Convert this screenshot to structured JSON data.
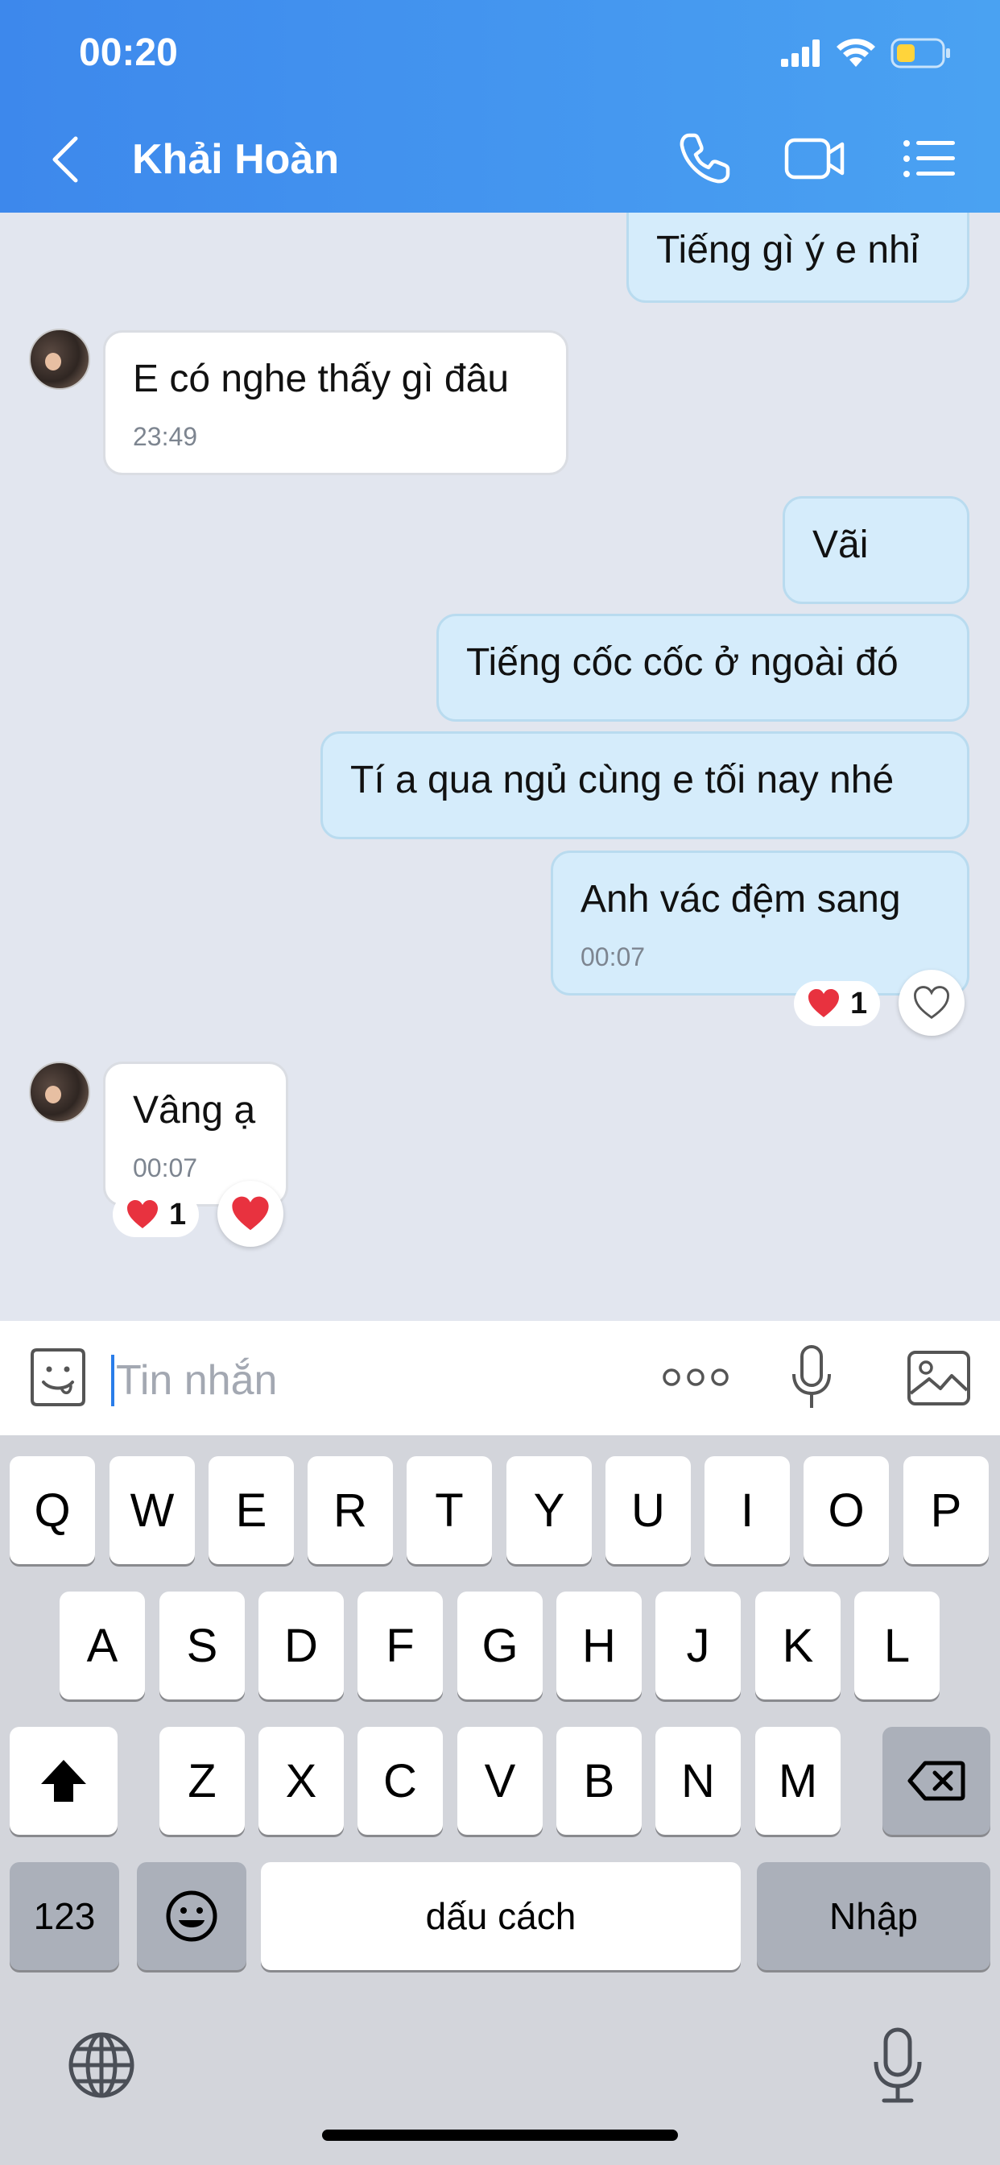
{
  "status_bar": {
    "time": "00:20"
  },
  "header": {
    "contact_name": "Khải Hoàn",
    "icons": [
      "back-icon",
      "phone-icon",
      "video-call-icon",
      "list-menu-icon"
    ]
  },
  "messages": [
    {
      "direction": "out",
      "text": "Tiếng gì ý e nhỉ"
    },
    {
      "direction": "in",
      "text": "E có nghe thấy gì đâu",
      "time": "23:49"
    },
    {
      "direction": "out",
      "text": "Vãi"
    },
    {
      "direction": "out",
      "text": "Tiếng cốc cốc ở ngoài đó"
    },
    {
      "direction": "out",
      "text": "Tí a qua ngủ cùng e tối nay nhé"
    },
    {
      "direction": "out",
      "text": "Anh vác đệm sang",
      "time": "00:07",
      "reaction_count": "1"
    },
    {
      "direction": "in",
      "text": "Vâng ạ",
      "time": "00:07",
      "reaction_count": "1"
    }
  ],
  "input": {
    "placeholder": "Tin nhắn"
  },
  "keyboard": {
    "row1": [
      "Q",
      "W",
      "E",
      "R",
      "T",
      "Y",
      "U",
      "I",
      "O",
      "P"
    ],
    "row2": [
      "A",
      "S",
      "D",
      "F",
      "G",
      "H",
      "J",
      "K",
      "L"
    ],
    "row3": [
      "Z",
      "X",
      "C",
      "V",
      "B",
      "N",
      "M"
    ],
    "numbers_label": "123",
    "space_label": "dấu cách",
    "return_label": "Nhập"
  },
  "colors": {
    "header_start": "#3d88ec",
    "header_end": "#4aa2f2",
    "outgoing_bubble": "#d5ecfb",
    "incoming_bubble": "#ffffff",
    "chat_background": "#e2e6ef",
    "heart": "#e8323f"
  }
}
